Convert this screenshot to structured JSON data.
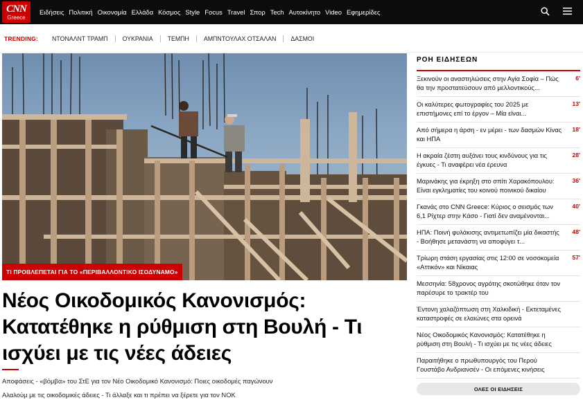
{
  "brand": {
    "logo_main": "CNN",
    "logo_sub": "Greece"
  },
  "nav": {
    "items": [
      "Ειδήσεις",
      "Πολιτική",
      "Οικονομία",
      "Ελλάδα",
      "Κόσμος",
      "Style",
      "Focus",
      "Travel",
      "Σπορ",
      "Tech",
      "Αυτοκίνητο",
      "Video",
      "Εφημερίδες"
    ],
    "icons": [
      "search-icon",
      "menu-icon"
    ]
  },
  "trending": {
    "label": "TRENDING:",
    "items": [
      "ΝΤΟΝΑΛΝΤ ΤΡΑΜΠ",
      "ΟΥΚΡΑΝΙΑ",
      "ΤΕΜΠΗ",
      "ΑΜΠΝΤΟΥΛΑΧ ΟΤΣΑΛΑΝ",
      "ΔΑΣΜΟΙ"
    ]
  },
  "main": {
    "kicker": "ΤΙ ΠΡΟΒΛΕΠΕΤΑΙ ΓΙΑ ΤΟ «ΠΕΡΙΒΑΛΛΟΝΤΙΚΟ ΙΣΟΔΥΝΑΜΟ»",
    "headline": "Νέος Οικοδομικός Κανονισμός: Κατατέθηκε η ρύθμιση στη Βουλή - Τι ισχύει με τις νέες άδειες",
    "related": [
      "Αποφάσεις - «βόμβα» του ΣτΕ για τον Νέο Οικοδομικό Κανονισμό: Ποιες οικοδομές παγώνουν",
      "Αλαλούμ με τις οικοδομικές άδειες - Τι άλλαξε και τι πρέπει να ξέρετε για τον ΝΟΚ"
    ]
  },
  "sidebar": {
    "title": "ΡΟΗ ΕΙΔΗΣΕΩΝ",
    "news": [
      {
        "title": "Ξεκινούν οι αναστηλώσεις στην Αγία Σοφία – Πώς θα την προστατεύσουν από μελλοντικούς...",
        "time": "6'"
      },
      {
        "title": "Οι καλύτερες φωτογραφίες του 2025 με επιστήμονες επί το έργον – Μία είναι...",
        "time": "13'"
      },
      {
        "title": "Από σήμερα η άρση - εν μέρει - των δασμών Κίνας και ΗΠΑ",
        "time": "18'"
      },
      {
        "title": "Η ακραία ζέστη αυξάνει τους κινδύνους για τις έγκυες - Τι αναφέρει νέα έρευνα",
        "time": "28'"
      },
      {
        "title": "Μαρινάκης για έκρηξη στο σπίτι Χαρακόπουλου: Είναι εγκληματίες του κοινού ποινικού δικαίου",
        "time": "36'"
      },
      {
        "title": "Γκανάς στο CNN Greece: Κύριος ο σεισμός των 6,1 Ρίχτερ στην Κάσο - Γιατί δεν αναμένονται...",
        "time": "40'"
      },
      {
        "title": "ΗΠΑ: Ποινή φυλάκισης αντιμετωπίζει μία δικαστής - Βοήθησε μετανάστη να αποφύγει τ...",
        "time": "48'"
      },
      {
        "title": "Τρίωρη στάση εργασίας στις 12:00 σε νοσοκομεία «Αττικόν» και Νίκαιας",
        "time": "57'"
      },
      {
        "title": "Μεσσηνία: 58χρονος αγρότης σκοτώθηκε όταν τον παρέσυρε το τρακτέρ του",
        "time": ""
      },
      {
        "title": "Έντονη χαλαζόπτωση στη Χαλκιδική - Εκτεταμένες καταστροφές σε ελαιώνες στα ορεινά",
        "time": ""
      },
      {
        "title": "Νέος Οικοδομικός Κανονισμός: Κατατέθηκε η ρύθμιση στη Βουλή - Τι ισχύει με τις νέες άδειες",
        "time": ""
      },
      {
        "title": "Παραιτήθηκε ο πρωθυπουργός του Περού Γουστάβο Ανδριανσέν - Οι επόμενες κινήσεις",
        "time": ""
      }
    ],
    "more_label": "ΟΛΕΣ ΟΙ ΕΙΔΗΣΕΙΣ"
  },
  "colors": {
    "accent": "#cc0000",
    "topbar": "#0c0c0c"
  }
}
